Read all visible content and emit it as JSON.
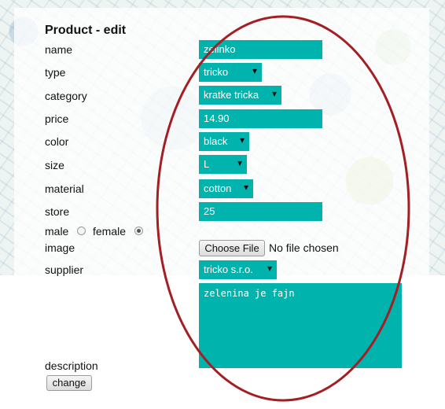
{
  "form": {
    "title": "Product - edit",
    "fields": {
      "name": {
        "label": "name",
        "value": "zelinko"
      },
      "type": {
        "label": "type",
        "value": "tricko"
      },
      "category": {
        "label": "category",
        "value": "kratke tricka"
      },
      "price": {
        "label": "price",
        "value": "14.90"
      },
      "color": {
        "label": "color",
        "value": "black"
      },
      "size": {
        "label": "size",
        "value": "L"
      },
      "material": {
        "label": "material",
        "value": "cotton"
      },
      "store": {
        "label": "store",
        "value": "25"
      },
      "gender": {
        "male_label": "male",
        "female_label": "female",
        "selected": "female"
      },
      "image": {
        "label": "image",
        "button_label": "Choose File",
        "status": "No file chosen"
      },
      "supplier": {
        "label": "supplier",
        "value": "tricko s.r.o."
      },
      "description": {
        "label": "description",
        "value": "zelenina je fajn"
      }
    },
    "submit_label": "change"
  },
  "colors": {
    "field_bg": "#00b3ad",
    "annotation_ellipse": "#a31f24"
  }
}
